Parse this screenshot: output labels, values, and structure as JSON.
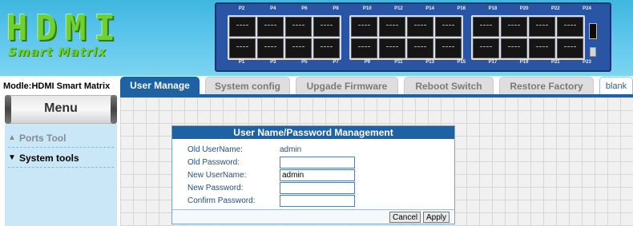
{
  "header": {
    "logo_main": "HDMI",
    "logo_sub": "Smart Matrix",
    "ports_top": [
      "P2",
      "P4",
      "P6",
      "P8",
      "P10",
      "P12",
      "P14",
      "P16",
      "P18",
      "P20",
      "P22",
      "P24"
    ],
    "ports_bottom": [
      "P1",
      "P3",
      "P5",
      "P7",
      "P9",
      "P11",
      "P13",
      "P15",
      "P17",
      "P19",
      "P21",
      "P23"
    ]
  },
  "sidebar": {
    "model": "Modle:HDMI Smart Matrix",
    "menu_title": "Menu",
    "items": [
      {
        "label": "Ports Tool",
        "icon": "collapsed-arrow-icon"
      },
      {
        "label": "System tools",
        "icon": "expanded-arrow-icon"
      }
    ]
  },
  "tabs": [
    {
      "label": "User Manage",
      "active": true
    },
    {
      "label": "System config",
      "active": false
    },
    {
      "label": "Upgade Firmware",
      "active": false
    },
    {
      "label": "Reboot Switch",
      "active": false
    },
    {
      "label": "Restore Factory",
      "active": false
    },
    {
      "label": "blank",
      "active": false
    }
  ],
  "dialog": {
    "title": "User Name/Password Management",
    "old_username_label": "Old UserName:",
    "old_username_value": "admin",
    "old_password_label": "Old Password:",
    "old_password_value": "",
    "new_username_label": "New UserName:",
    "new_username_value": "admin",
    "new_password_label": "New Password:",
    "new_password_value": "",
    "confirm_password_label": "Confirm Password:",
    "confirm_password_value": "",
    "cancel_label": "Cancel",
    "apply_label": "Apply"
  },
  "colors": {
    "header_blue": "#58c3ea",
    "logo_green": "#6ed032",
    "tab_active": "#1e62a4",
    "panel_blue": "#2a54a4"
  }
}
